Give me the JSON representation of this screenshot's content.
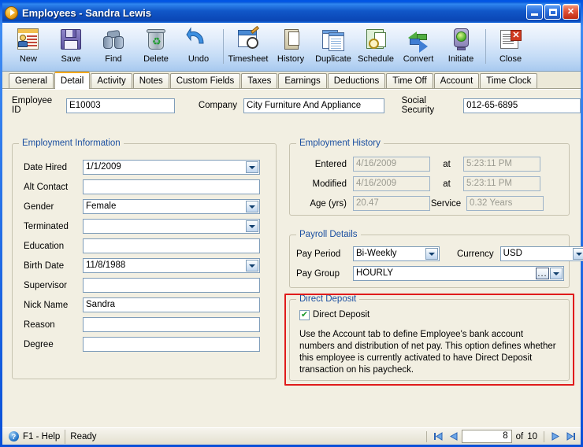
{
  "window": {
    "title_main": "Employees",
    "title_sep": " - ",
    "title_sub": "Sandra Lewis",
    "icon": "app-play-icon",
    "minimize": "_",
    "maximize": "[]",
    "close": "X"
  },
  "toolbar": {
    "items": [
      {
        "label": "New",
        "icon": "new-record-icon"
      },
      {
        "label": "Save",
        "icon": "save-floppy-icon"
      },
      {
        "label": "Find",
        "icon": "find-binoculars-icon"
      },
      {
        "label": "Delete",
        "icon": "delete-recycle-bin-icon"
      },
      {
        "label": "Undo",
        "icon": "undo-arrow-icon"
      },
      {
        "label": "Timesheet",
        "icon": "timesheet-icon"
      },
      {
        "label": "History",
        "icon": "history-hourglass-icon"
      },
      {
        "label": "Duplicate",
        "icon": "duplicate-icon"
      },
      {
        "label": "Schedule",
        "icon": "schedule-icon"
      },
      {
        "label": "Convert",
        "icon": "convert-arrows-icon"
      },
      {
        "label": "Initiate",
        "icon": "initiate-trafficlight-icon"
      },
      {
        "label": "Close",
        "icon": "close-document-icon"
      }
    ]
  },
  "tabs": [
    {
      "label": "General",
      "active": false
    },
    {
      "label": "Detail",
      "active": true
    },
    {
      "label": "Activity",
      "active": false
    },
    {
      "label": "Notes",
      "active": false
    },
    {
      "label": "Custom Fields",
      "active": false
    },
    {
      "label": "Taxes",
      "active": false
    },
    {
      "label": "Earnings",
      "active": false
    },
    {
      "label": "Deductions",
      "active": false
    },
    {
      "label": "Time Off",
      "active": false
    },
    {
      "label": "Account",
      "active": false
    },
    {
      "label": "Time Clock",
      "active": false
    }
  ],
  "header_fields": {
    "employee_id_label": "Employee ID",
    "employee_id_value": "E10003",
    "company_label": "Company",
    "company_value": "City Furniture And Appliance",
    "ssn_label": "Social Security",
    "ssn_value": "012-65-6895"
  },
  "employment_information": {
    "title": "Employment Information",
    "fields": [
      {
        "label": "Date Hired",
        "value": "1/1/2009",
        "type": "combo"
      },
      {
        "label": "Alt Contact",
        "value": "",
        "type": "text"
      },
      {
        "label": "Gender",
        "value": "Female",
        "type": "combo"
      },
      {
        "label": "Terminated",
        "value": "",
        "type": "combo"
      },
      {
        "label": "Education",
        "value": "",
        "type": "text"
      },
      {
        "label": "Birth Date",
        "value": "11/8/1988",
        "type": "combo"
      },
      {
        "label": "Supervisor",
        "value": "",
        "type": "text"
      },
      {
        "label": "Nick Name",
        "value": "Sandra",
        "type": "text"
      },
      {
        "label": "Reason",
        "value": "",
        "type": "text"
      },
      {
        "label": "Degree",
        "value": "",
        "type": "text"
      }
    ]
  },
  "employment_history": {
    "title": "Employment History",
    "rows": [
      {
        "label": "Entered",
        "value": "4/16/2009",
        "mid": "at",
        "value2": "5:23:11 PM"
      },
      {
        "label": "Modified",
        "value": "4/16/2009",
        "mid": "at",
        "value2": "5:23:11 PM"
      },
      {
        "label": "Age (yrs)",
        "value": "20.47",
        "mid": "Service",
        "value2": "0.32 Years"
      }
    ]
  },
  "payroll_details": {
    "title": "Payroll Details",
    "pay_period_label": "Pay Period",
    "pay_period_value": "Bi-Weekly",
    "currency_label": "Currency",
    "currency_value": "USD",
    "pay_group_label": "Pay Group",
    "pay_group_value": "HOURLY",
    "ellipsis_label": "..."
  },
  "direct_deposit": {
    "title": "Direct Deposit",
    "checkbox_label": "Direct Deposit",
    "checked": true,
    "description": "Use the Account tab to define Employee's bank account numbers and distribution of net pay. This option defines whether this employee is currently activated to have Direct Deposit transaction on his paycheck.",
    "highlight_color": "#e01b1b"
  },
  "statusbar": {
    "help_label": "F1 - Help",
    "status_label": "Ready",
    "record_current": "8",
    "of_label": "of",
    "record_total": "10",
    "first_glyph": "⏮",
    "prev_glyph": "◀",
    "next_glyph": "▶",
    "last_glyph": "⏭"
  },
  "colors": {
    "titlebar_blue": "#0a50d8",
    "group_title_blue": "#1b4fa0",
    "active_tab_accent": "#f2a81c",
    "form_background": "#f2efe2"
  }
}
